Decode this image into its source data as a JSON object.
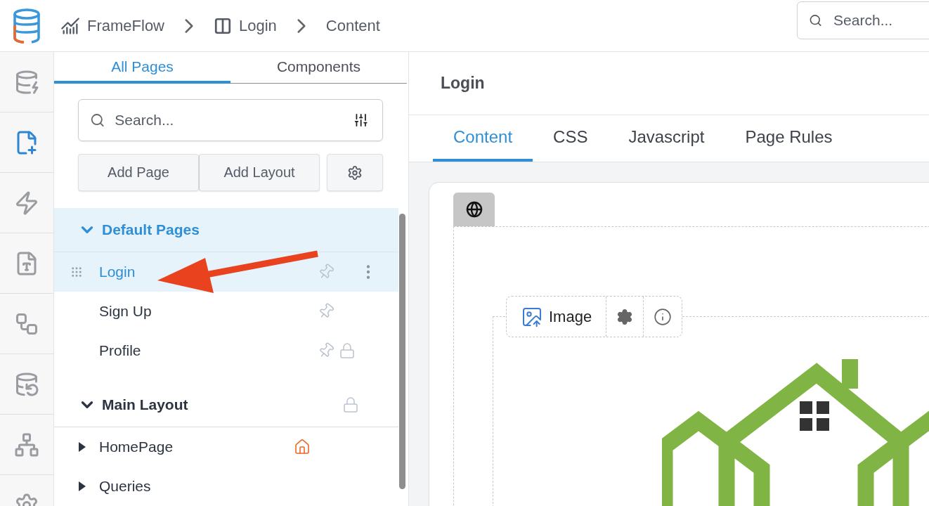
{
  "header": {
    "breadcrumbs": [
      {
        "kind": "app",
        "label": "FrameFlow"
      },
      {
        "kind": "page",
        "label": "Login"
      },
      {
        "kind": "plain",
        "label": "Content"
      }
    ],
    "search": {
      "placeholder": "Search..."
    }
  },
  "rail": [
    {
      "kind": "database-add",
      "selected": false
    },
    {
      "kind": "page-add",
      "selected": true
    },
    {
      "kind": "actions",
      "selected": false
    },
    {
      "kind": "pdf",
      "selected": false
    },
    {
      "kind": "pipes",
      "selected": false
    },
    {
      "kind": "database-import",
      "selected": false
    },
    {
      "kind": "network",
      "selected": false
    },
    {
      "kind": "settings",
      "selected": false
    }
  ],
  "sidebar": {
    "tabs": [
      {
        "label": "All Pages",
        "selected": true
      },
      {
        "label": "Components",
        "selected": false
      }
    ],
    "search": {
      "placeholder": "Search..."
    },
    "buttons": [
      "Add Page",
      "Add Layout"
    ],
    "groups": [
      {
        "title": "Default Pages",
        "expanded": true,
        "selected": true,
        "locked": false,
        "pages": [
          {
            "label": "Login",
            "selected": true,
            "pinned": true,
            "locked": false,
            "home": false,
            "menu": true
          },
          {
            "label": "Sign Up",
            "selected": false,
            "pinned": true,
            "locked": false,
            "home": false,
            "menu": false
          },
          {
            "label": "Profile",
            "selected": false,
            "pinned": true,
            "locked": true,
            "home": false,
            "menu": false
          }
        ]
      },
      {
        "title": "Main Layout",
        "expanded": true,
        "selected": false,
        "locked": true,
        "pages": [
          {
            "label": "HomePage",
            "selected": false,
            "pinned": false,
            "locked": false,
            "home": true,
            "menu": false,
            "expanded": false
          },
          {
            "label": "Queries",
            "selected": false,
            "pinned": false,
            "locked": false,
            "home": false,
            "menu": false,
            "expanded": false
          }
        ]
      }
    ]
  },
  "main": {
    "title": "Login",
    "tabs": [
      {
        "label": "Content",
        "selected": true
      },
      {
        "label": "CSS",
        "selected": false
      },
      {
        "label": "Javascript",
        "selected": false
      },
      {
        "label": "Page Rules",
        "selected": false
      }
    ],
    "canvas": {
      "element_label": "Image"
    }
  }
}
